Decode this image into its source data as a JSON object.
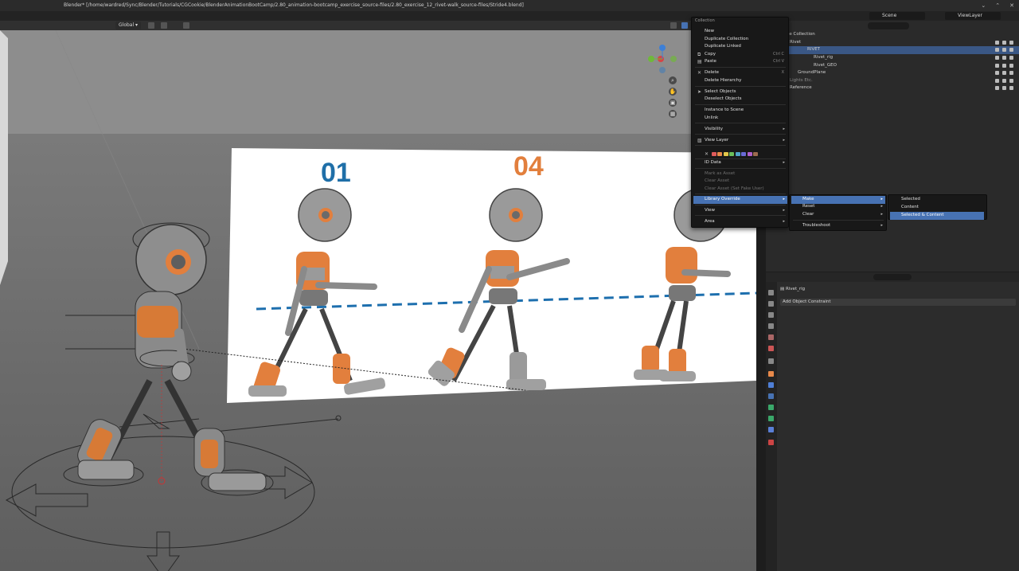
{
  "window": {
    "title": "Blender* [/home/wardred/Sync/Blender/Tutorials/CGCookie/BlenderAnimationBootCamp/2.80_animation-bootcamp_exercise_source-files/2.80_exercise_12_rivet-walk_source-files/Stride4.blend]"
  },
  "topbar": {
    "scene": "Scene",
    "view_layer": "ViewLayer"
  },
  "viewport": {
    "orientation": "Global",
    "reference_labels": [
      "01",
      "04"
    ],
    "colors": {
      "blue_label": "#1f6fa8",
      "orange_label": "#e27f3d",
      "dash_line": "#1d6fae"
    }
  },
  "outliner": {
    "items": [
      {
        "label": "me Collection"
      },
      {
        "label": "Rivet"
      },
      {
        "label": "RIVET"
      },
      {
        "label": "Rivet_rig"
      },
      {
        "label": "Rivet_GEO"
      },
      {
        "label": "GroundPlane"
      },
      {
        "label": "Lights Etc."
      },
      {
        "label": "Reference"
      }
    ]
  },
  "properties": {
    "object_name": "Rivet_rig",
    "add_constraint_label": "Add Object Constraint"
  },
  "context_menu": {
    "title": "Collection",
    "items": {
      "new": "New",
      "duplicate_collection": "Duplicate Collection",
      "duplicate_linked": "Duplicate Linked",
      "copy": "Copy",
      "copy_shortcut": "Ctrl C",
      "paste": "Paste",
      "paste_shortcut": "Ctrl V",
      "delete": "Delete",
      "delete_shortcut": "X",
      "delete_hierarchy": "Delete Hierarchy",
      "select_objects": "Select Objects",
      "deselect_objects": "Deselect Objects",
      "instance_to_scene": "Instance to Scene",
      "unlink": "Unlink",
      "visibility": "Visibility",
      "view_layer": "View Layer",
      "id_data": "ID Data",
      "mark_as_asset": "Mark as Asset",
      "clear_asset": "Clear Asset",
      "clear_asset_fake_user": "Clear Asset (Set Fake User)",
      "library_override": "Library Override",
      "view": "View",
      "area": "Area"
    },
    "color_tags": [
      "#e05b5b",
      "#e8894a",
      "#e3c74a",
      "#6bbf5a",
      "#4fa3c7",
      "#6a6ad6",
      "#b061c9",
      "#9b6b4e"
    ]
  },
  "override_submenu": {
    "make": "Make",
    "reset": "Reset",
    "clear": "Clear",
    "troubleshoot": "Troubleshoot"
  },
  "make_submenu": {
    "selected": "Selected",
    "content": "Content",
    "selected_and_content": "Selected & Content"
  }
}
